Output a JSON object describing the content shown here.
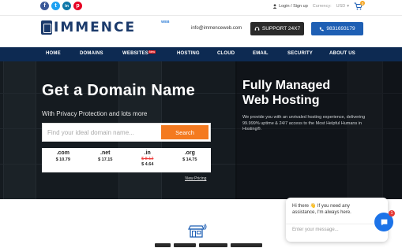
{
  "topbar": {
    "social": [
      {
        "icon": "facebook-icon",
        "glyph": "f",
        "color": "#3b5998"
      },
      {
        "icon": "twitter-icon",
        "glyph": "t",
        "color": "#1da1f2"
      },
      {
        "icon": "linkedin-icon",
        "glyph": "in",
        "color": "#0e76a8"
      },
      {
        "icon": "pinterest-icon",
        "glyph": "p",
        "color": "#e60023"
      }
    ],
    "login_label": "Login / Sign up",
    "currency_label": "Currency:",
    "currency_value": "USD",
    "cart_count": "0"
  },
  "header": {
    "logo_text": "IMMENCE",
    "logo_sup": "WEB",
    "email": "info@immenceweb.com",
    "support_label": "SUPPORT 24X7",
    "phone_label": "9831693179"
  },
  "nav": {
    "items": [
      "HOME",
      "DOMAINS",
      "WEBSITES",
      "HOSTING",
      "CLOUD",
      "EMAIL",
      "SECURITY",
      "ABOUT US"
    ],
    "new_badge": "New"
  },
  "hero": {
    "title": "Get a Domain Name",
    "subtitle": "With Privacy Protection and lots more",
    "search_placeholder": "Find your ideal domain name...",
    "search_button": "Search",
    "prices": [
      {
        "ext": ".com",
        "price": "$ 10.79",
        "old": ""
      },
      {
        "ext": ".net",
        "price": "$ 17.15",
        "old": ""
      },
      {
        "ext": ".in",
        "price": "$ 4.64",
        "old": "$ 8.12"
      },
      {
        "ext": ".org",
        "price": "$ 14.75",
        "old": ""
      }
    ],
    "view_pricing": "View Pricing",
    "right_title_line1": "Fully Managed",
    "right_title_line2": "Web Hosting",
    "right_desc": "We provide you with an unrivaled hosting experience, delivering 99.999% uptime & 24/7 access to the Most Helpful Humans in Hosting®."
  },
  "chat": {
    "message": "Hi there 👋 If you need any assistance, I'm always here.",
    "input_placeholder": "Enter your message...",
    "badge": "1"
  },
  "colors": {
    "navy": "#0d2a52",
    "accent_orange": "#f47a20",
    "phone_blue": "#1e5fb4",
    "chat_blue": "#1c73e8"
  }
}
